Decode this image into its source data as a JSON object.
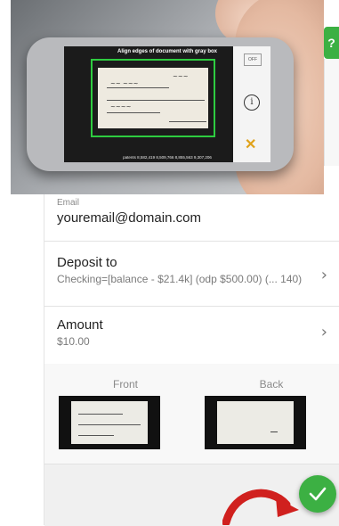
{
  "camera": {
    "hint": "Align edges of document with gray box",
    "flash_label": "OFF",
    "info_glyph": "i",
    "close_glyph": "✕",
    "patents": "patents 8,582,419 8,509,766 8,855,563 9,307,206"
  },
  "help": {
    "glyph": "?"
  },
  "form": {
    "email": {
      "label": "Email",
      "value": "youremail@domain.com"
    },
    "deposit_to": {
      "title": "Deposit to",
      "value": "Checking=[balance - $21.4k] (odp $500.00) (... 140)"
    },
    "amount": {
      "title": "Amount",
      "value": "$10.00"
    },
    "images": {
      "front_label": "Front",
      "back_label": "Back"
    }
  },
  "colors": {
    "accent_green": "#3cb043",
    "arrow_red": "#d0201e",
    "divider": "#e3e3e3"
  },
  "icons": {
    "chevron": "chevron-right-icon",
    "submit": "checkmark-icon",
    "arrow": "curved-arrow-icon"
  }
}
